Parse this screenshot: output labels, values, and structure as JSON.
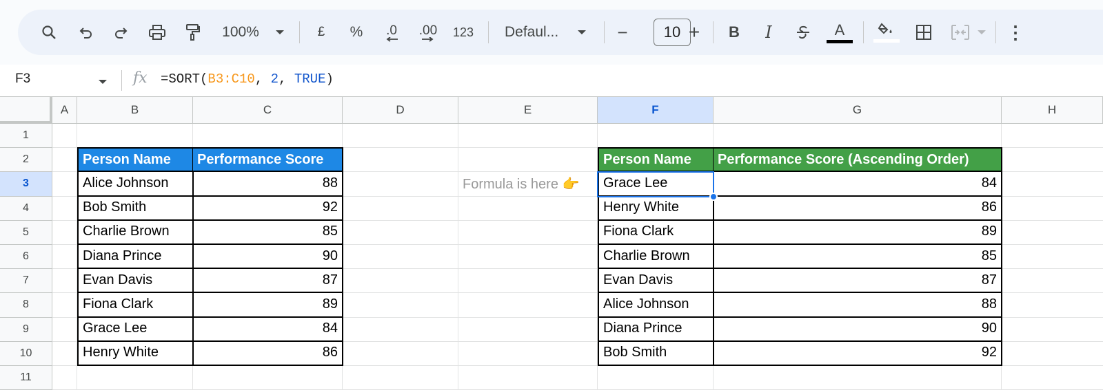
{
  "toolbar": {
    "zoom": "100%",
    "currency": "£",
    "percent": "%",
    "decrease_decimal": ".0",
    "increase_decimal": ".00",
    "number_format": "123",
    "font": "Defaul...",
    "font_size": "10",
    "minus": "−",
    "plus": "+",
    "bold": "B",
    "italic": "I",
    "text_color_letter": "A",
    "more": "⋮"
  },
  "formula_bar": {
    "cell_ref": "F3",
    "fx": "fx",
    "formula_prefix": "=SORT(",
    "formula_range": "B3:C10",
    "formula_sep1": ", ",
    "formula_num": "2",
    "formula_sep2": ", ",
    "formula_bool": "TRUE",
    "formula_suffix": ")"
  },
  "columns": [
    "A",
    "B",
    "C",
    "D",
    "E",
    "F",
    "G",
    "H"
  ],
  "rows": [
    "1",
    "2",
    "3",
    "4",
    "5",
    "6",
    "7",
    "8",
    "9",
    "10",
    "11"
  ],
  "selected": {
    "column": "F",
    "row": "3"
  },
  "left_table": {
    "headers": [
      "Person Name",
      "Performance Score"
    ],
    "rows": [
      [
        "Alice Johnson",
        "88"
      ],
      [
        "Bob Smith",
        "92"
      ],
      [
        "Charlie Brown",
        "85"
      ],
      [
        "Diana Prince",
        "90"
      ],
      [
        "Evan Davis",
        "87"
      ],
      [
        "Fiona Clark",
        "89"
      ],
      [
        "Grace Lee",
        "84"
      ],
      [
        "Henry White",
        "86"
      ]
    ]
  },
  "note": "Formula is here 👉",
  "right_table": {
    "headers": [
      "Person Name",
      "Performance Score (Ascending Order)"
    ],
    "rows": [
      [
        "Grace Lee",
        "84"
      ],
      [
        "Henry White",
        "86"
      ],
      [
        "Fiona Clark",
        "89"
      ],
      [
        "Charlie Brown",
        "85"
      ],
      [
        "Evan Davis",
        "87"
      ],
      [
        "Alice Johnson",
        "88"
      ],
      [
        "Diana Prince",
        "90"
      ],
      [
        "Bob Smith",
        "92"
      ]
    ]
  },
  "colors": {
    "header_blue": "#1e88e5",
    "header_green": "#43a047",
    "selection": "#1a73e8"
  }
}
